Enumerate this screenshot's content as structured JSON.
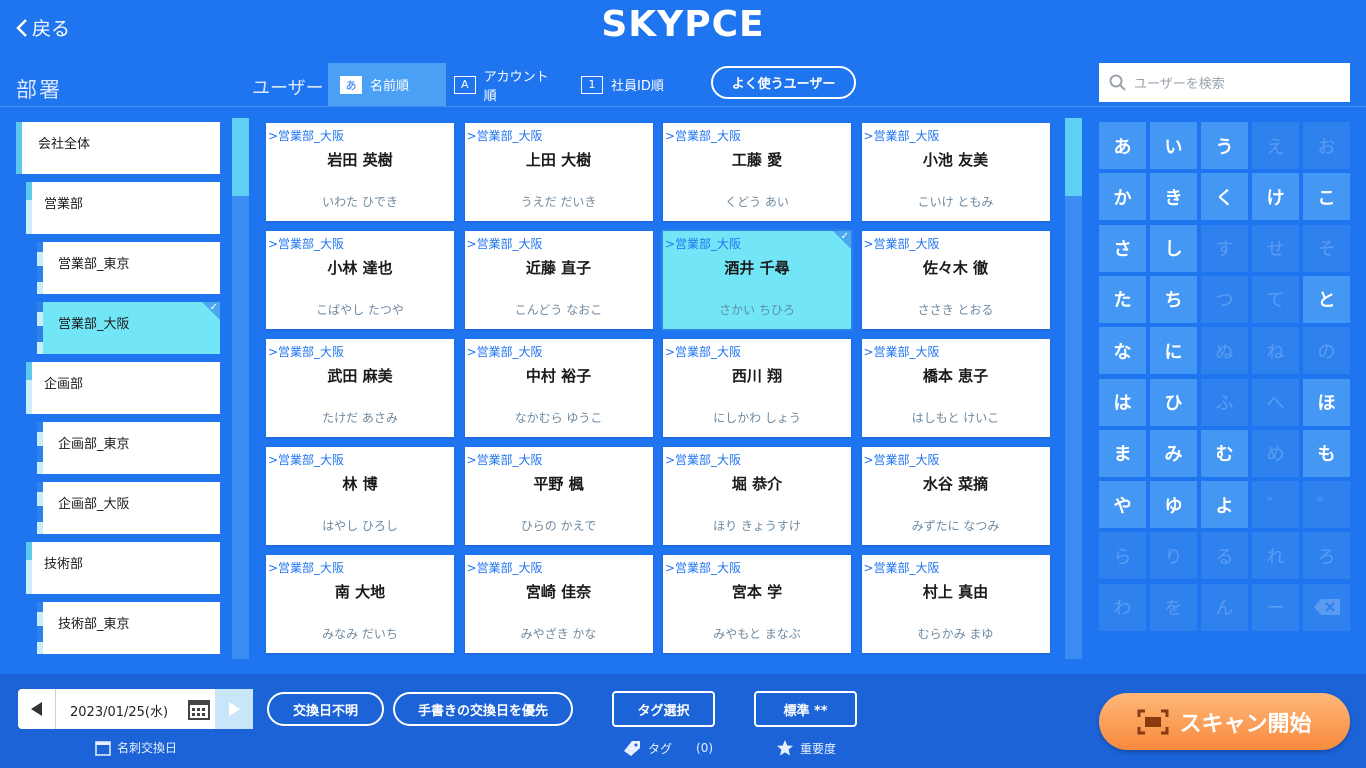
{
  "header": {
    "back_label": "戻る",
    "logo": "SKYPCE"
  },
  "labels": {
    "departments": "部署",
    "users": "ユーザー"
  },
  "sort_tabs": [
    {
      "badge": "あ",
      "label": "名前順",
      "active": true
    },
    {
      "badge": "A",
      "label": "アカウント順",
      "active": false
    },
    {
      "badge": "1",
      "label": "社員ID順",
      "active": false
    }
  ],
  "frequent_users_label": "よく使うユーザー",
  "search": {
    "placeholder": "ユーザーを検索"
  },
  "departments": [
    {
      "label": "会社全体",
      "level": 0,
      "selected": false
    },
    {
      "label": "営業部",
      "level": 1,
      "selected": false
    },
    {
      "label": "営業部_東京",
      "level": 2,
      "selected": false
    },
    {
      "label": "営業部_大阪",
      "level": 2,
      "selected": true
    },
    {
      "label": "企画部",
      "level": 1,
      "selected": false
    },
    {
      "label": "企画部_東京",
      "level": 2,
      "selected": false
    },
    {
      "label": "企画部_大阪",
      "level": 2,
      "selected": false
    },
    {
      "label": "技術部",
      "level": 1,
      "selected": false
    },
    {
      "label": "技術部_東京",
      "level": 2,
      "selected": false
    }
  ],
  "users": [
    {
      "dept": ">営業部_大阪",
      "name": "岩田 英樹",
      "kana": "いわた ひでき"
    },
    {
      "dept": ">営業部_大阪",
      "name": "上田 大樹",
      "kana": "うえだ だいき"
    },
    {
      "dept": ">営業部_大阪",
      "name": "工藤 愛",
      "kana": "くどう あい"
    },
    {
      "dept": ">営業部_大阪",
      "name": "小池 友美",
      "kana": "こいけ ともみ"
    },
    {
      "dept": ">営業部_大阪",
      "name": "小林 達也",
      "kana": "こばやし たつや"
    },
    {
      "dept": ">営業部_大阪",
      "name": "近藤 直子",
      "kana": "こんどう なおこ"
    },
    {
      "dept": ">営業部_大阪",
      "name": "酒井 千尋",
      "kana": "さかい ちひろ",
      "selected": true
    },
    {
      "dept": ">営業部_大阪",
      "name": "佐々木 徹",
      "kana": "ささき とおる"
    },
    {
      "dept": ">営業部_大阪",
      "name": "武田 麻美",
      "kana": "たけだ あさみ"
    },
    {
      "dept": ">営業部_大阪",
      "name": "中村 裕子",
      "kana": "なかむら ゆうこ"
    },
    {
      "dept": ">営業部_大阪",
      "name": "西川 翔",
      "kana": "にしかわ しょう"
    },
    {
      "dept": ">営業部_大阪",
      "name": "橋本 恵子",
      "kana": "はしもと けいこ"
    },
    {
      "dept": ">営業部_大阪",
      "name": "林 博",
      "kana": "はやし ひろし"
    },
    {
      "dept": ">営業部_大阪",
      "name": "平野 楓",
      "kana": "ひらの かえで"
    },
    {
      "dept": ">営業部_大阪",
      "name": "堀 恭介",
      "kana": "ほり きょうすけ"
    },
    {
      "dept": ">営業部_大阪",
      "name": "水谷 菜摘",
      "kana": "みずたに なつみ"
    },
    {
      "dept": ">営業部_大阪",
      "name": "南 大地",
      "kana": "みなみ だいち"
    },
    {
      "dept": ">営業部_大阪",
      "name": "宮崎 佳奈",
      "kana": "みやざき かな"
    },
    {
      "dept": ">営業部_大阪",
      "name": "宮本 学",
      "kana": "みやもと まなぶ"
    },
    {
      "dept": ">営業部_大阪",
      "name": "村上 真由",
      "kana": "むらかみ まゆ"
    }
  ],
  "kana_keys": [
    [
      "あ",
      "い",
      "う",
      "え",
      "お"
    ],
    [
      "か",
      "き",
      "く",
      "け",
      "こ"
    ],
    [
      "さ",
      "し",
      "す",
      "せ",
      "そ"
    ],
    [
      "た",
      "ち",
      "つ",
      "て",
      "と"
    ],
    [
      "な",
      "に",
      "ぬ",
      "ね",
      "の"
    ],
    [
      "は",
      "ひ",
      "ふ",
      "へ",
      "ほ"
    ],
    [
      "ま",
      "み",
      "む",
      "め",
      "も"
    ],
    [
      "や",
      "ゆ",
      "よ",
      "゛",
      "゜"
    ],
    [
      "ら",
      "り",
      "る",
      "れ",
      "ろ"
    ],
    [
      "わ",
      "を",
      "ん",
      "ー",
      "⌫"
    ]
  ],
  "kana_enabled": [
    [
      true,
      true,
      true,
      false,
      false
    ],
    [
      true,
      true,
      true,
      true,
      true
    ],
    [
      true,
      true,
      false,
      false,
      false
    ],
    [
      true,
      true,
      false,
      false,
      true
    ],
    [
      true,
      true,
      false,
      false,
      false
    ],
    [
      true,
      true,
      false,
      false,
      true
    ],
    [
      true,
      true,
      true,
      false,
      true
    ],
    [
      true,
      true,
      true,
      false,
      false
    ],
    [
      false,
      false,
      false,
      false,
      false
    ],
    [
      false,
      false,
      false,
      false,
      false
    ]
  ],
  "bottom": {
    "date": "2023/01/25(水)",
    "date_label": "名刺交換日",
    "unknown_date": "交換日不明",
    "prefer_handwritten": "手書きの交換日を優先",
    "tag_select": "タグ選択",
    "tag_label": "タグ",
    "tag_count": "(0)",
    "importance": "標準 **",
    "importance_label": "重要度",
    "scan_start": "スキャン開始"
  }
}
